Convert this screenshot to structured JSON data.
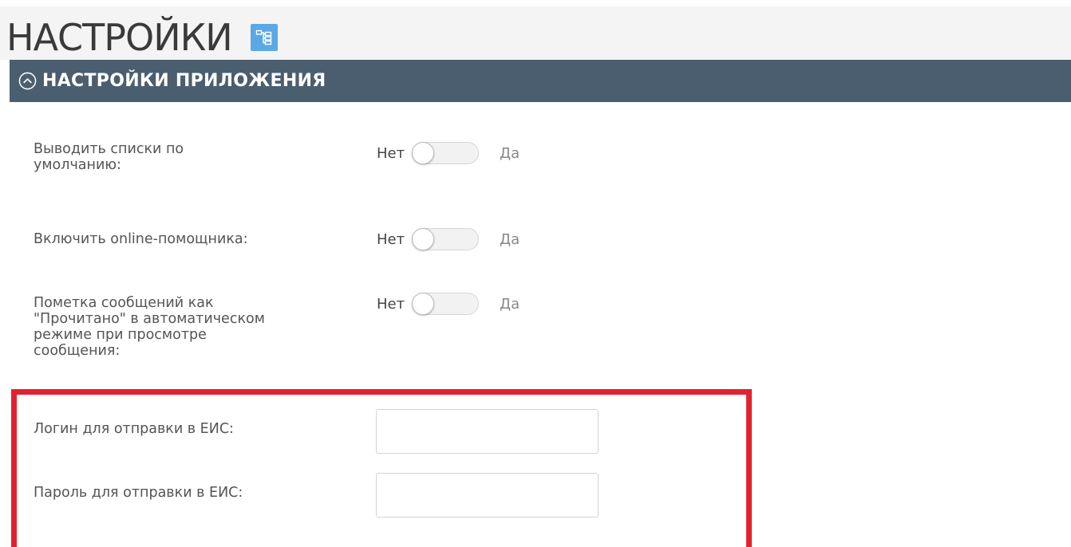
{
  "header": {
    "title": "НАСТРОЙКИ",
    "structure_icon": "structure-tree-icon"
  },
  "section": {
    "title": "НАСТРОЙКИ ПРИЛОЖЕНИЯ",
    "collapse_icon": "chevron-up-circle-icon"
  },
  "settings": [
    {
      "label": "Выводить списки по умолчанию:",
      "off_label": "Нет",
      "on_label": "Да",
      "value": false
    },
    {
      "label": "Включить online-помощника:",
      "off_label": "Нет",
      "on_label": "Да",
      "value": false
    },
    {
      "label": "Пометка сообщений как \"Прочитано\" в автоматическом режиме при просмотре сообщения:",
      "off_label": "Нет",
      "on_label": "Да",
      "value": false
    }
  ],
  "eis": {
    "login_label": "Логин для отправки в ЕИС:",
    "login_value": "",
    "password_label": "Пароль для отправки в ЕИС:",
    "password_value": ""
  },
  "colors": {
    "section_header_bg": "#4b5e70",
    "highlight_border": "#e3222f",
    "structure_button_bg": "#5aa8e6"
  }
}
